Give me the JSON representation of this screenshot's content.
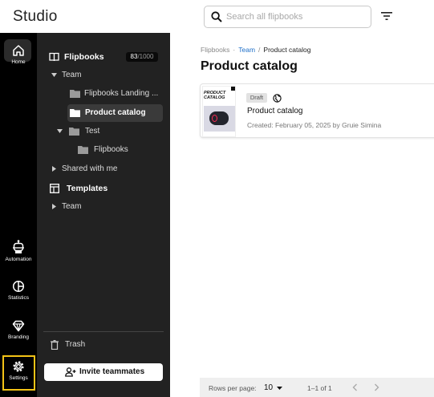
{
  "app": {
    "logo": "Studio"
  },
  "search": {
    "placeholder": "Search all flipbooks"
  },
  "rail": {
    "home": "Home",
    "automation": "Automation",
    "statistics": "Statistics",
    "branding": "Branding",
    "settings": "Settings"
  },
  "sidebar": {
    "flipbooks_label": "Flipbooks",
    "count_used": "83",
    "count_total": "/1000",
    "tree": {
      "team": "Team",
      "landing": "Flipbooks Landing ...",
      "product_catalog": "Product catalog",
      "test": "Test",
      "flipbooks_folder": "Flipbooks",
      "shared": "Shared with me"
    },
    "templates_label": "Templates",
    "templates_team": "Team",
    "trash": "Trash",
    "invite": "Invite teammates"
  },
  "main": {
    "breadcrumb": {
      "root": "Flipbooks",
      "sep1": "·",
      "team": "Team",
      "sep2": "/",
      "current": "Product catalog"
    },
    "title": "Product catalog",
    "card": {
      "status": "Draft",
      "name": "Product catalog",
      "created": "Created: February 05, 2025 by Gruie Simina",
      "thumb_text": "PRODUCT CATALOG"
    },
    "pagination": {
      "rows_label": "Rows per page:",
      "rows_value": "10",
      "range": "1–1 of 1"
    }
  },
  "colors": {
    "rail": "#000000",
    "panel": "#222222",
    "highlight": "#f3c316",
    "link": "#1e6fc8"
  }
}
